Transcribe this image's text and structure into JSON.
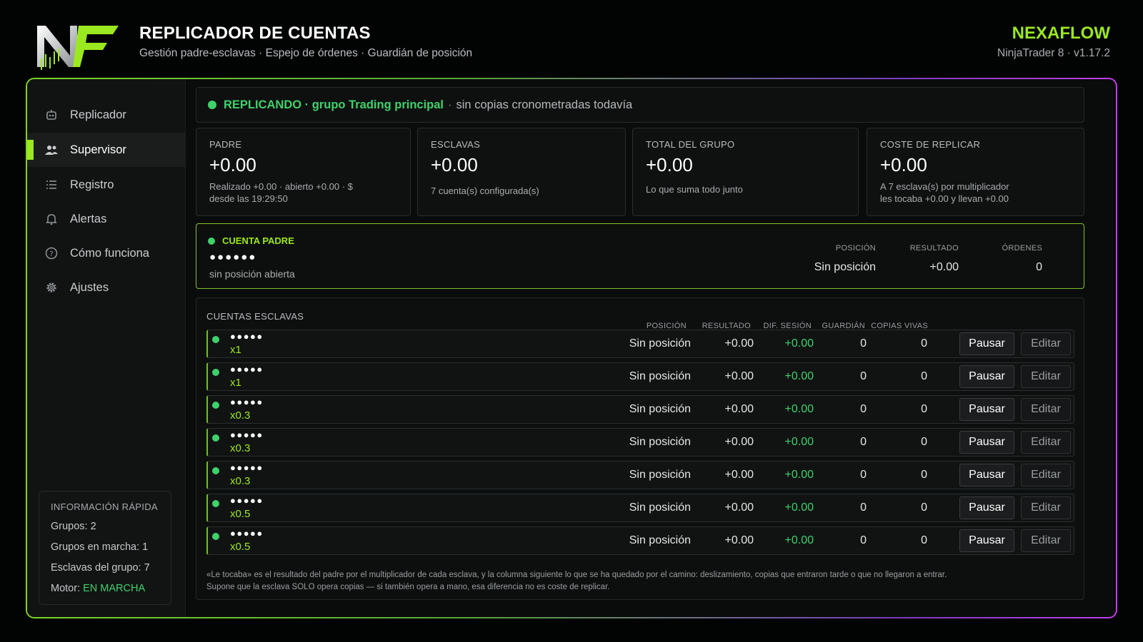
{
  "header": {
    "title": "REPLICADOR DE CUENTAS",
    "subtitle": "Gestión padre-esclavas · Espejo de órdenes · Guardián de posición",
    "brand": "NEXAFLOW",
    "version": "NinjaTrader 8 · v1.17.2"
  },
  "colors": {
    "accent": "#9ae81f",
    "status_green": "#3fd16a",
    "frame_purple": "#c040e8"
  },
  "sidebar": {
    "items": [
      {
        "label": "Replicador",
        "icon": "robot-icon",
        "active": false
      },
      {
        "label": "Supervisor",
        "icon": "users-icon",
        "active": true
      },
      {
        "label": "Registro",
        "icon": "list-icon",
        "active": false
      },
      {
        "label": "Alertas",
        "icon": "bell-icon",
        "active": false
      },
      {
        "label": "Cómo funciona",
        "icon": "help-circle-icon",
        "active": false
      },
      {
        "label": "Ajustes",
        "icon": "gear-icon",
        "active": false
      }
    ],
    "quick_info": {
      "title": "INFORMACIÓN RÁPIDA",
      "groups": "Grupos: 2",
      "running": "Grupos en marcha: 1",
      "slaves": "Esclavas del grupo: 7",
      "engine_label": "Motor:",
      "engine_value": "EN MARCHA"
    }
  },
  "status": {
    "main": "REPLICANDO · grupo Trading principal",
    "sep": "·",
    "sub": "sin copias cronometradas todavía"
  },
  "cards": [
    {
      "title": "PADRE",
      "value": "+0.00",
      "note1": "Realizado +0.00 · abierto +0.00 · $",
      "note2": "desde las 19:29:50"
    },
    {
      "title": "ESCLAVAS",
      "value": "+0.00",
      "note1": "7 cuenta(s) configurada(s)",
      "note2": ""
    },
    {
      "title": "TOTAL DEL GRUPO",
      "value": "+0.00",
      "note1": "Lo que suma todo junto",
      "note2": ""
    },
    {
      "title": "COSTE DE REPLICAR",
      "value": "+0.00",
      "note1": "A 7 esclava(s) por multiplicador",
      "note2": "les tocaba +0.00 y llevan +0.00"
    }
  ],
  "parent": {
    "title": "CUENTA PADRE",
    "masked": "●●●●●●",
    "note": "sin posición abierta",
    "headers": {
      "position": "POSICIÓN",
      "result": "RESULTADO",
      "orders": "ÓRDENES"
    },
    "values": {
      "position": "Sin posición",
      "result": "+0.00",
      "orders": "0"
    }
  },
  "slaves": {
    "title": "CUENTAS ESCLAVAS",
    "headers": {
      "position": "POSICIÓN",
      "result": "RESULTADO",
      "diff": "DIF. SESIÓN",
      "guardian": "GUARDIÁN",
      "live": "COPIAS VIVAS"
    },
    "pause_label": "Pausar",
    "edit_label": "Editar",
    "rows": [
      {
        "masked": "●●●●●",
        "mult": "x1",
        "position": "Sin posición",
        "result": "+0.00",
        "diff": "+0.00",
        "guardian": "0",
        "live": "0"
      },
      {
        "masked": "●●●●●",
        "mult": "x1",
        "position": "Sin posición",
        "result": "+0.00",
        "diff": "+0.00",
        "guardian": "0",
        "live": "0"
      },
      {
        "masked": "●●●●●",
        "mult": "x0.3",
        "position": "Sin posición",
        "result": "+0.00",
        "diff": "+0.00",
        "guardian": "0",
        "live": "0"
      },
      {
        "masked": "●●●●●",
        "mult": "x0.3",
        "position": "Sin posición",
        "result": "+0.00",
        "diff": "+0.00",
        "guardian": "0",
        "live": "0"
      },
      {
        "masked": "●●●●●",
        "mult": "x0.3",
        "position": "Sin posición",
        "result": "+0.00",
        "diff": "+0.00",
        "guardian": "0",
        "live": "0"
      },
      {
        "masked": "●●●●●",
        "mult": "x0.5",
        "position": "Sin posición",
        "result": "+0.00",
        "diff": "+0.00",
        "guardian": "0",
        "live": "0"
      },
      {
        "masked": "●●●●●",
        "mult": "x0.5",
        "position": "Sin posición",
        "result": "+0.00",
        "diff": "+0.00",
        "guardian": "0",
        "live": "0"
      }
    ],
    "footnote1": "«Le tocaba» es el resultado del padre por el multiplicador de cada esclava, y la columna siguiente lo que se ha quedado por el camino: deslizamiento, copias que entraron tarde o que no llegaron a entrar.",
    "footnote2": "Supone que la esclava SOLO opera copias — si también opera a mano, esa diferencia no es coste de replicar."
  }
}
